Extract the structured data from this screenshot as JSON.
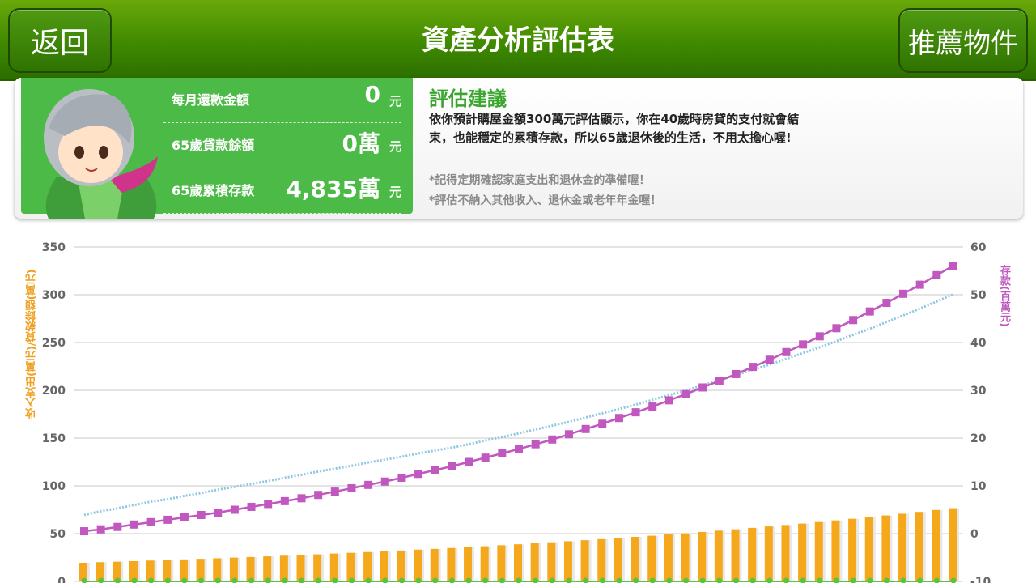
{
  "header": {
    "title": "資產分析評估表",
    "back_label": "返回",
    "recommend_label": "推薦物件"
  },
  "summary": {
    "rows": [
      {
        "label": "每月還款金額",
        "value": "0",
        "unit": "元"
      },
      {
        "label": "65歲貸款餘額",
        "value": "0萬",
        "unit": "元"
      },
      {
        "label": "65歲累積存款",
        "value": "4,835萬",
        "unit": "元"
      }
    ]
  },
  "advice": {
    "title": "評估建議",
    "body": "依你預計購屋金額300萬元評估顯示，你在40歲時房貸的支付就會結束，也能穩定的累積存款，所以65歲退休後的生活，不用太擔心喔!",
    "note1": "*記得定期確認家庭支出和退休金的準備喔！",
    "note2": "*評估不納入其他收入、退休金或老年年金喔！"
  },
  "colors": {
    "header_green": "#4f9a12",
    "panel_green": "#4cba46",
    "bar_orange": "#f5a81c",
    "savings_purple": "#c058c0",
    "trend_blue": "#8ec8e0",
    "loan_green": "#5cc040"
  },
  "chart_data": {
    "type": "bar",
    "left_axis_label": "收入支出(萬元)/貸款餘額(萬元)",
    "right_axis_label": "存款(百萬元)",
    "left_ticks": [
      "0",
      "50",
      "100",
      "150",
      "200",
      "250",
      "300",
      "350"
    ],
    "right_ticks": [
      "-10",
      "0",
      "10",
      "20",
      "30",
      "40",
      "50",
      "60"
    ],
    "ylim_left": [
      0,
      350
    ],
    "ylim_right": [
      -10,
      60
    ],
    "grid": true,
    "series": [
      {
        "type": "bar",
        "axis": "left",
        "values": [
          19.5,
          20.1,
          20.6,
          21.2,
          21.8,
          22.4,
          23.0,
          23.6,
          24.2,
          24.9,
          25.5,
          26.2,
          26.9,
          27.6,
          28.3,
          29.1,
          29.9,
          30.7,
          31.5,
          32.3,
          33.2,
          34.0,
          34.9,
          35.9,
          36.8,
          37.8,
          38.8,
          39.8,
          40.9,
          42.0,
          43.1,
          44.2,
          45.4,
          46.6,
          47.8,
          49.1,
          50.4,
          51.7,
          53.1,
          54.5,
          56.0,
          57.5,
          59.0,
          60.5,
          62.1,
          63.8,
          65.5,
          67.2,
          69.0,
          70.8,
          72.7,
          74.7,
          76.6
        ]
      },
      {
        "type": "line",
        "axis": "left",
        "values": [
          0,
          0,
          0,
          0,
          0,
          0,
          0,
          0,
          0,
          0,
          0,
          0,
          0,
          0,
          0,
          0,
          0,
          0,
          0,
          0,
          0,
          0,
          0,
          0,
          0,
          0,
          0,
          0,
          0,
          0,
          0,
          0,
          0,
          0,
          0,
          0,
          0,
          0,
          0,
          0,
          0,
          0,
          0,
          0,
          0,
          0,
          0,
          0,
          0,
          0,
          0,
          0,
          0
        ]
      },
      {
        "type": "line",
        "axis": "right",
        "values": [
          0.5,
          0.9,
          1.4,
          1.9,
          2.4,
          2.9,
          3.4,
          3.9,
          4.4,
          5.0,
          5.6,
          6.2,
          6.8,
          7.4,
          8.1,
          8.8,
          9.5,
          10.2,
          10.9,
          11.7,
          12.5,
          13.3,
          14.1,
          15.0,
          15.9,
          16.8,
          17.7,
          18.7,
          19.7,
          20.8,
          21.9,
          23.0,
          24.2,
          25.4,
          26.6,
          27.9,
          29.2,
          30.6,
          32.0,
          33.4,
          34.9,
          36.4,
          38.0,
          39.6,
          41.3,
          43.0,
          44.7,
          46.5,
          48.3,
          50.2,
          52.1,
          54.1,
          56.1
        ]
      },
      {
        "type": "line",
        "axis": "right",
        "style": "dotted",
        "values": [
          3.9,
          4.7,
          5.3,
          6.0,
          6.7,
          7.2,
          7.9,
          8.5,
          9.2,
          9.8,
          10.4,
          11.0,
          11.7,
          12.3,
          13.0,
          13.6,
          14.2,
          14.9,
          15.5,
          16.1,
          16.8,
          17.4,
          18.0,
          18.7,
          19.5,
          20.2,
          21.0,
          21.8,
          22.6,
          23.4,
          24.3,
          25.2,
          26.1,
          27.0,
          28.0,
          29.0,
          30.0,
          31.0,
          32.1,
          33.2,
          34.3,
          35.4,
          36.6,
          37.8,
          39.0,
          40.3,
          41.6,
          42.9,
          44.3,
          45.7,
          47.1,
          48.6,
          50.1
        ]
      }
    ]
  }
}
